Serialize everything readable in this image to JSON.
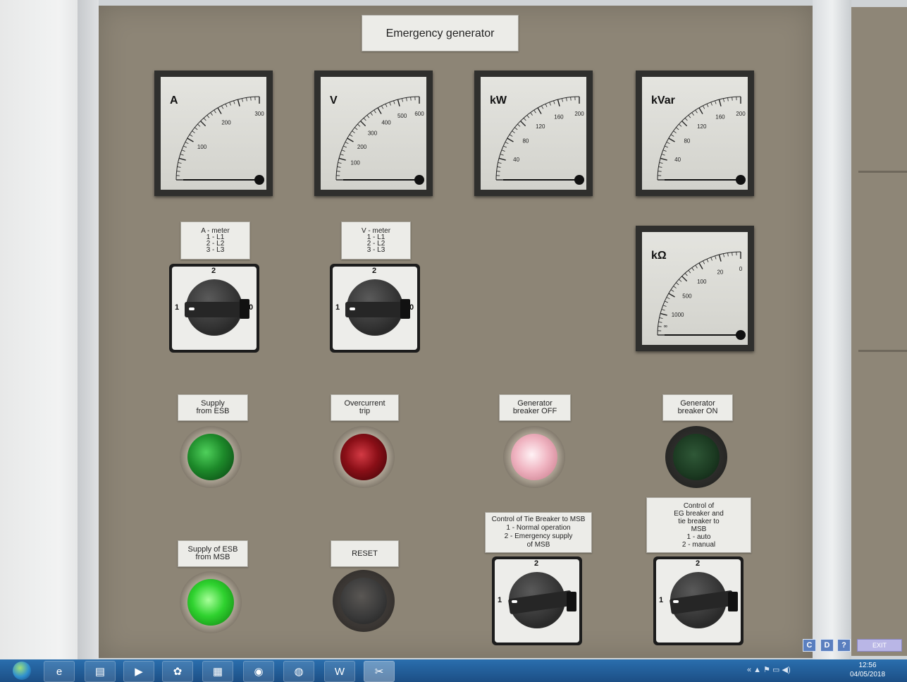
{
  "title": "Emergency generator",
  "meters": [
    {
      "unit": "A",
      "ticks": [
        "100",
        "200",
        "300"
      ],
      "value_fraction": 0
    },
    {
      "unit": "V",
      "ticks": [
        "100",
        "200",
        "300",
        "400",
        "500",
        "600"
      ],
      "value_fraction": 0
    },
    {
      "unit": "kW",
      "ticks": [
        "40",
        "80",
        "120",
        "160",
        "200"
      ],
      "value_fraction": 0
    },
    {
      "unit": "kVar",
      "ticks": [
        "40",
        "80",
        "120",
        "160",
        "200"
      ],
      "value_fraction": 0
    },
    {
      "unit": "kΩ",
      "ticks": [
        "1000",
        "500",
        "100",
        "20",
        "0"
      ],
      "extra_tick": "∞",
      "value_fraction": 0
    }
  ],
  "selectors": {
    "a_meter": {
      "label": "A - meter\n1 - L1\n2 - L2\n3 - L3",
      "positions": [
        "1",
        "2",
        "0"
      ],
      "selected": "1"
    },
    "v_meter": {
      "label": "V - meter\n1 - L1\n2 - L2\n3 - L3",
      "positions": [
        "1",
        "2",
        "0"
      ],
      "selected": "1"
    },
    "tie_breaker": {
      "label": "Control of Tie Breaker to MSB\n1 - Normal operation\n2 - Emergency supply\nof MSB",
      "positions": [
        "1",
        "2"
      ],
      "selected": "1"
    },
    "eg_breaker": {
      "label": "Control of\nEG breaker and\ntie breaker to\nMSB\n1 - auto\n2 - manual",
      "positions": [
        "1",
        "2"
      ],
      "selected": "1"
    }
  },
  "lamps": {
    "supply_from_esb": {
      "label": "Supply\nfrom ESB",
      "color": "#1d8a2a",
      "state": "on"
    },
    "overcurrent_trip": {
      "label": "Overcurrent\ntrip",
      "color": "#8a0f17",
      "state": "on"
    },
    "gen_breaker_off": {
      "label": "Generator\nbreaker OFF",
      "color": "#f0b5c2",
      "state": "on"
    },
    "gen_breaker_on": {
      "label": "Generator\nbreaker ON",
      "color": "#1c3b22",
      "state": "off"
    },
    "supply_esb_from_msb": {
      "label": "Supply of ESB\nfrom MSB",
      "color": "#2fd22f",
      "state": "on"
    },
    "reset": {
      "label": "RESET",
      "color": "#3a3a3a",
      "state": "button"
    }
  },
  "corner_buttons": {
    "c": "C",
    "d": "D",
    "help": "?",
    "exit": "EXIT"
  },
  "taskbar": {
    "apps": [
      "ie-icon",
      "explorer-icon",
      "media-player-icon",
      "paint-icon",
      "calc-icon",
      "chrome-icon",
      "firefox-icon",
      "word-icon",
      "snipping-tool-icon"
    ],
    "time": "12:56",
    "date": "04/05/2018"
  }
}
